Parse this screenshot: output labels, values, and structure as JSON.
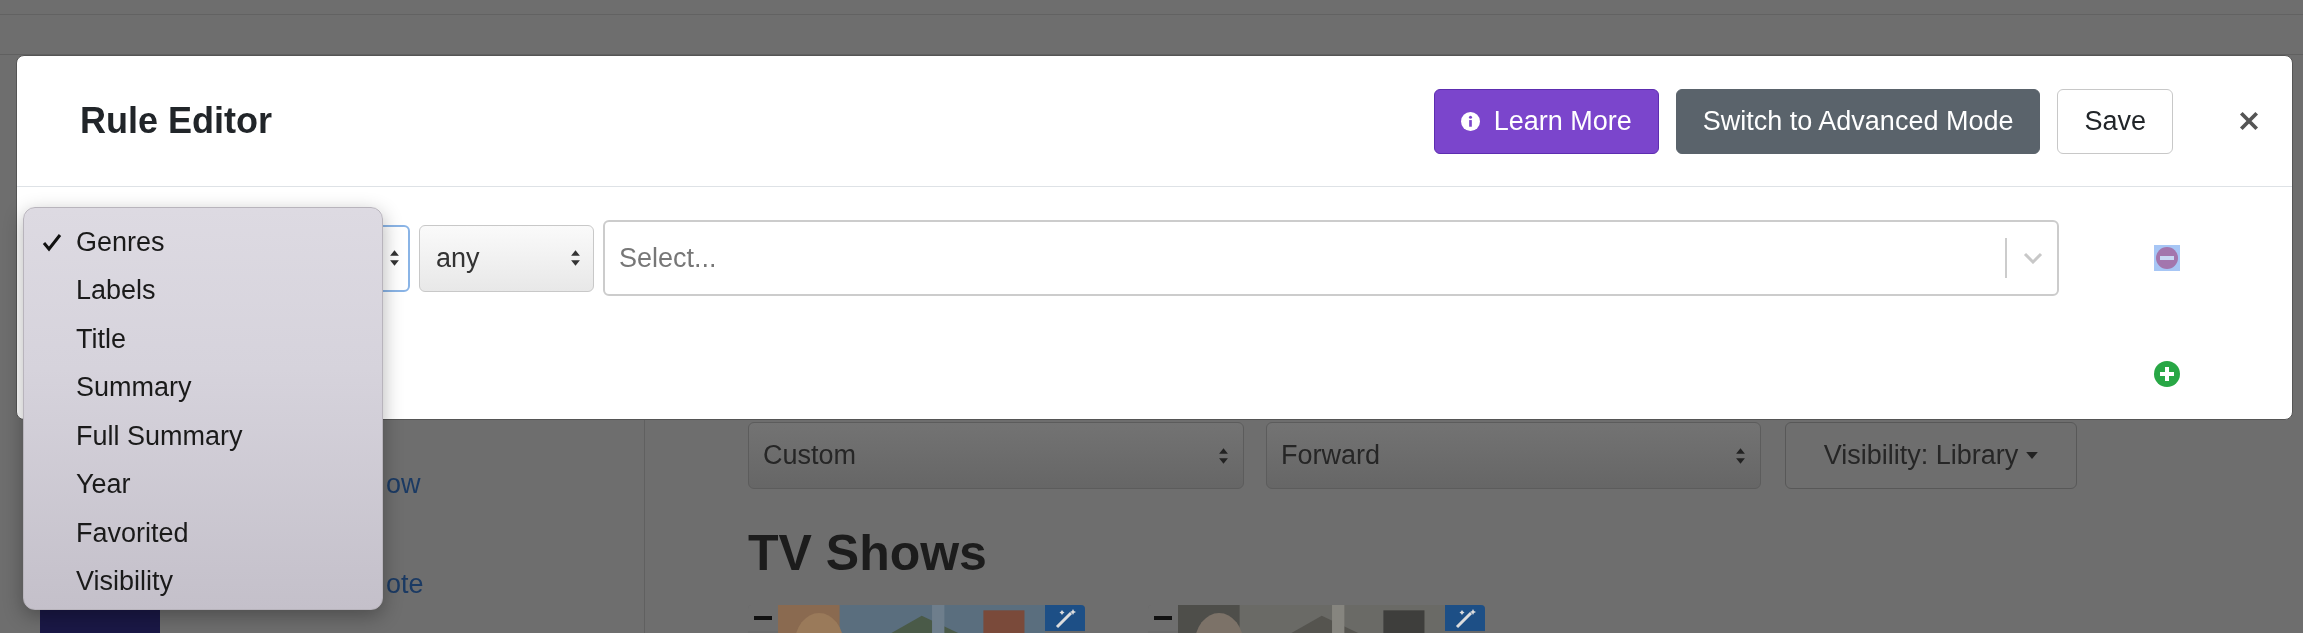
{
  "page": {
    "sidebar_links": [
      {
        "label": "ow"
      },
      {
        "label": "ote"
      }
    ],
    "sort_selects": [
      {
        "value": "Custom"
      },
      {
        "value": "Forward"
      }
    ],
    "visibility_button": "Visibility: Library",
    "section_title": "TV Shows"
  },
  "modal": {
    "title": "Rule Editor",
    "buttons": [
      {
        "label": "Learn More",
        "kind": "info"
      },
      {
        "label": "Switch to Advanced Mode",
        "kind": "secondary"
      },
      {
        "label": "Save",
        "kind": "outline"
      }
    ],
    "rule": {
      "operator": "any",
      "value_placeholder": "Select..."
    },
    "field_options": [
      {
        "label": "Genres",
        "selected": true
      },
      {
        "label": "Labels",
        "selected": false
      },
      {
        "label": "Title",
        "selected": false
      },
      {
        "label": "Summary",
        "selected": false
      },
      {
        "label": "Full Summary",
        "selected": false
      },
      {
        "label": "Year",
        "selected": false
      },
      {
        "label": "Favorited",
        "selected": false
      },
      {
        "label": "Visibility",
        "selected": false
      }
    ]
  }
}
